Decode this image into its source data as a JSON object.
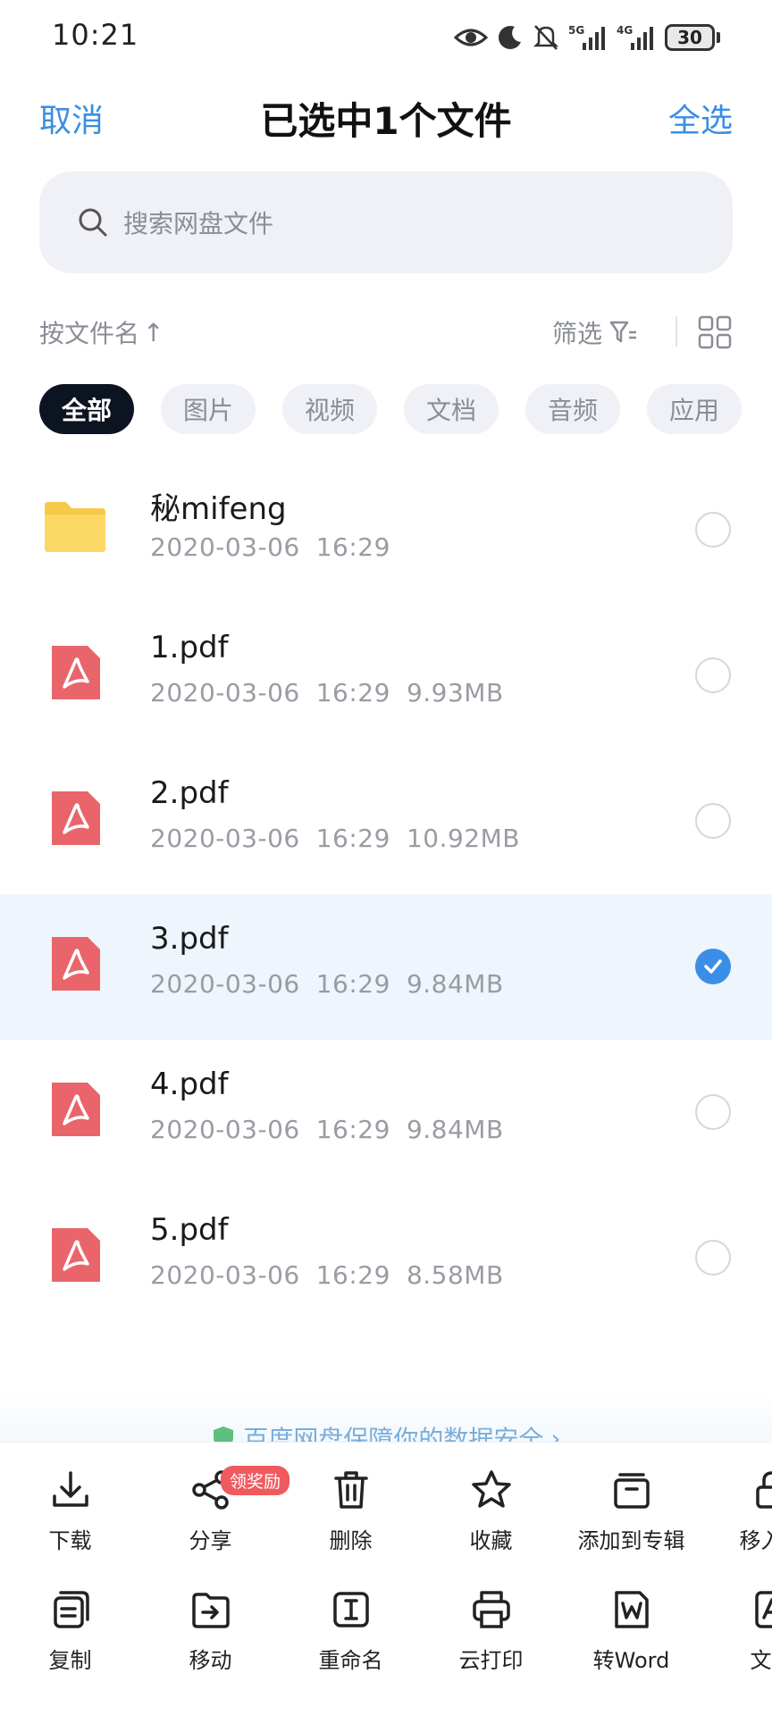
{
  "status_bar": {
    "time": "10:21",
    "battery": "30",
    "signal_labels": [
      "5G",
      "4G"
    ]
  },
  "header": {
    "cancel": "取消",
    "title": "已选中1个文件",
    "select_all": "全选"
  },
  "search": {
    "placeholder": "搜索网盘文件"
  },
  "sort": {
    "label": "按文件名",
    "arrow": "↑",
    "filter": "筛选"
  },
  "categories": [
    "全部",
    "图片",
    "视频",
    "文档",
    "音频",
    "应用"
  ],
  "files": [
    {
      "name": "秘mifeng",
      "date": "2020-03-06",
      "time": "16:29",
      "size": "",
      "type": "folder",
      "selected": false
    },
    {
      "name": "1.pdf",
      "date": "2020-03-06",
      "time": "16:29",
      "size": "9.93MB",
      "type": "pdf",
      "selected": false
    },
    {
      "name": "2.pdf",
      "date": "2020-03-06",
      "time": "16:29",
      "size": "10.92MB",
      "type": "pdf",
      "selected": false
    },
    {
      "name": "3.pdf",
      "date": "2020-03-06",
      "time": "16:29",
      "size": "9.84MB",
      "type": "pdf",
      "selected": true
    },
    {
      "name": "4.pdf",
      "date": "2020-03-06",
      "time": "16:29",
      "size": "9.84MB",
      "type": "pdf",
      "selected": false
    },
    {
      "name": "5.pdf",
      "date": "2020-03-06",
      "time": "16:29",
      "size": "8.58MB",
      "type": "pdf",
      "selected": false
    }
  ],
  "banner": {
    "text": "百度网盘保障你的数据安全",
    "arrow": "›"
  },
  "actions": {
    "row1": [
      {
        "label": "下载",
        "icon": "download-icon"
      },
      {
        "label": "分享",
        "icon": "share-icon",
        "badge": "领奖励"
      },
      {
        "label": "删除",
        "icon": "trash-icon"
      },
      {
        "label": "收藏",
        "icon": "star-icon"
      },
      {
        "label": "添加到专辑",
        "icon": "album-icon"
      },
      {
        "label": "移入隐",
        "icon": "lock-icon"
      }
    ],
    "row2": [
      {
        "label": "复制",
        "icon": "copy-icon"
      },
      {
        "label": "移动",
        "icon": "move-icon"
      },
      {
        "label": "重命名",
        "icon": "rename-icon"
      },
      {
        "label": "云打印",
        "icon": "print-icon"
      },
      {
        "label": "转Word",
        "icon": "word-icon"
      },
      {
        "label": "文档",
        "icon": "document-icon"
      }
    ]
  },
  "colors": {
    "accent": "#3a8ee6",
    "selected_row": "#eef5fc",
    "chip_active": "#0d1421",
    "pdf_red": "#e9656b",
    "folder_yellow": "#f7c948",
    "badge_red": "#ef5a5f"
  }
}
